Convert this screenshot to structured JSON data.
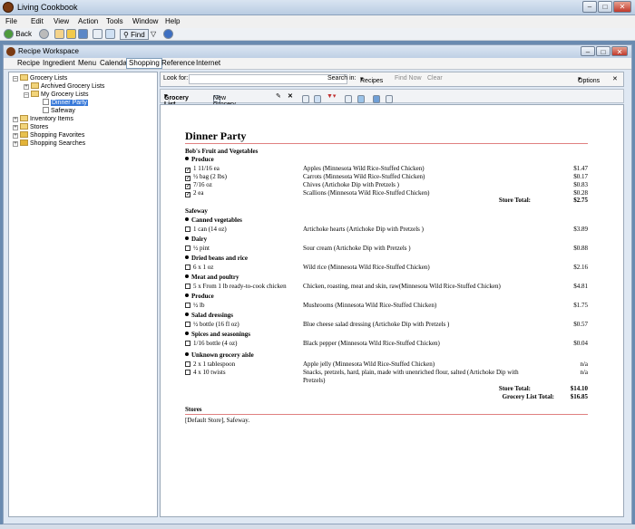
{
  "window": {
    "title": "Living Cookbook"
  },
  "menu": [
    "File",
    "Edit",
    "View",
    "Action",
    "Tools",
    "Window",
    "Help"
  ],
  "toolbar": {
    "back": "Back",
    "find": "Find"
  },
  "workspace": {
    "title": "Recipe Workspace"
  },
  "tabs": [
    "Recipe",
    "Ingredient",
    "Menu",
    "Calendar",
    "Shopping",
    "Reference",
    "Internet"
  ],
  "tree": {
    "grocery_lists": "Grocery Lists",
    "archived": "Archived Grocery Lists",
    "my_lists": "My Grocery Lists",
    "dinner_party": "Dinner Party",
    "safeway": "Safeway",
    "inventory": "Inventory Items",
    "stores": "Stores",
    "favorites": "Shopping Favorites",
    "searches": "Shopping Searches"
  },
  "search": {
    "look_for": "Look for:",
    "search_in": "Search in:",
    "recipes": "Recipes",
    "find_now": "Find Now",
    "clear": "Clear",
    "options": "Options"
  },
  "gltoolbar": {
    "grocery_list": "Grocery List",
    "new_list": "New Grocery List"
  },
  "doc": {
    "title": "Dinner Party",
    "store1": "Bob's Fruit and Vegetables",
    "store1_cat": "Produce",
    "store1_items": [
      {
        "qty": "1 11/16 ea",
        "desc": "Apples (Minnesota Wild Rice-Stuffed Chicken)",
        "price": "$1.47"
      },
      {
        "qty": "½ bag (2 lbs)",
        "desc": "Carrots (Minnesota Wild Rice-Stuffed Chicken)",
        "price": "$0.17"
      },
      {
        "qty": "7/16 oz",
        "desc": "Chives (Artichoke Dip with Pretzels )",
        "price": "$0.83"
      },
      {
        "qty": "2 ea",
        "desc": "Scallions (Minnesota Wild Rice-Stuffed Chicken)",
        "price": "$0.28"
      }
    ],
    "store_total_label": "Store Total:",
    "store1_total": "$2.75",
    "store2": "Safeway",
    "store2_groups": [
      {
        "cat": "Canned vegetables",
        "items": [
          {
            "qty": "1 can (14 oz)",
            "desc": "Artichoke hearts (Artichoke Dip with Pretzels )",
            "price": "$3.89"
          }
        ]
      },
      {
        "cat": "Dairy",
        "items": [
          {
            "qty": "½ pint",
            "desc": "Sour cream (Artichoke Dip with Pretzels )",
            "price": "$0.88"
          }
        ]
      },
      {
        "cat": "Dried beans and rice",
        "items": [
          {
            "qty": "6 x 1 oz",
            "desc": "Wild rice  (Minnesota Wild Rice-Stuffed Chicken)",
            "price": "$2.16"
          }
        ]
      },
      {
        "cat": "Meat and poultry",
        "items": [
          {
            "qty": "5 x From 1 lb ready-to-cook chicken",
            "desc": "Chicken, roasting, meat and skin, raw(Minnesota Wild Rice-Stuffed Chicken)",
            "price": "$4.81"
          }
        ]
      },
      {
        "cat": "Produce",
        "items": [
          {
            "qty": "½ lb",
            "desc": "Mushrooms (Minnesota Wild Rice-Stuffed Chicken)",
            "price": "$1.75"
          }
        ]
      },
      {
        "cat": "Salad dressings",
        "items": [
          {
            "qty": "½ bottle (16 fl oz)",
            "desc": "Blue cheese salad dressing (Artichoke Dip with Pretzels )",
            "price": "$0.57"
          }
        ]
      },
      {
        "cat": "Spices and seasonings",
        "items": [
          {
            "qty": "1/16 bottle (4 oz)",
            "desc": "Black pepper (Minnesota Wild Rice-Stuffed Chicken)",
            "price": "$0.04"
          }
        ]
      }
    ],
    "unknown_cat": "Unknown grocery aisle",
    "unknown_items": [
      {
        "qty": "2 x 1 tablespoon",
        "desc": "Apple jelly (Minnesota Wild Rice-Stuffed Chicken)",
        "price": "n/a"
      },
      {
        "qty": "4 x 10 twists",
        "desc": "Snacks, pretzels, hard, plain, made with unenriched flour, salted (Artichoke Dip with",
        "desc2": "Pretzels)",
        "price": "n/a"
      }
    ],
    "store2_total": "$14.10",
    "grocery_total_label": "Grocery List Total:",
    "grocery_total": "$16.85",
    "stores_heading": "Stores",
    "stores_text": "[Default Store], Safeway."
  }
}
